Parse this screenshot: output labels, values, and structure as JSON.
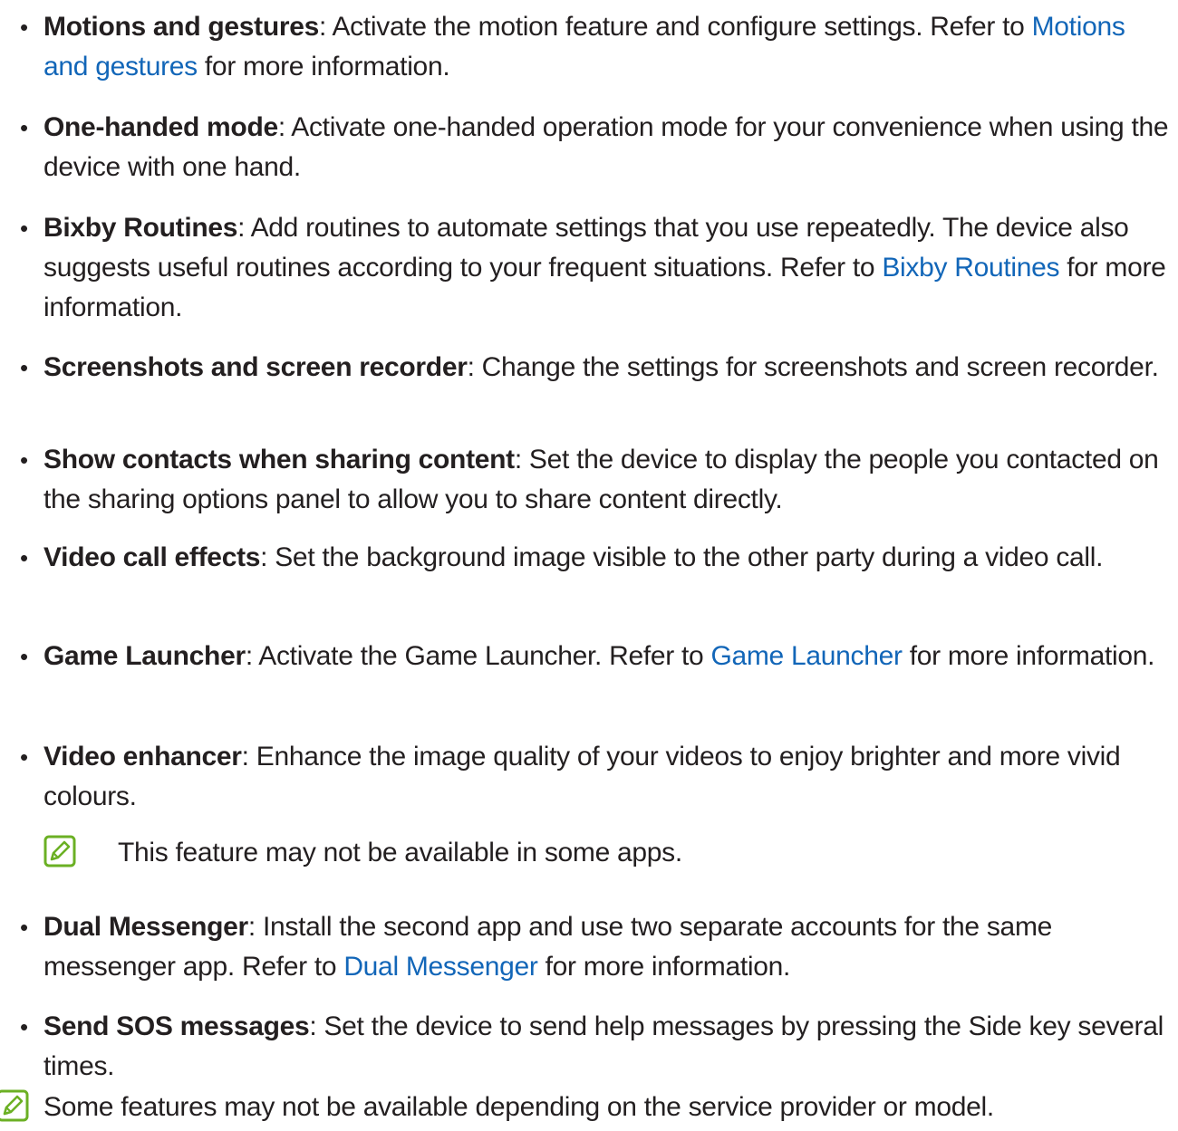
{
  "items": [
    {
      "title": "Motions and gestures",
      "parts": [
        ": Activate the motion feature and configure settings. Refer to ",
        "Motions and gestures",
        " for more information."
      ]
    },
    {
      "title": "One-handed mode",
      "parts": [
        ": Activate one-handed operation mode for your convenience when using the device with one hand."
      ]
    },
    {
      "title": "Bixby Routines",
      "parts": [
        ": Add routines to automate settings that you use repeatedly. The device also suggests useful routines according to your frequent situations. Refer to ",
        "Bixby Routines",
        " for more information."
      ]
    },
    {
      "title": "Screenshots and screen recorder",
      "parts": [
        ": Change the settings for screenshots and screen recorder."
      ]
    },
    {
      "title": "Show contacts when sharing content",
      "parts": [
        ": Set the device to display the people you contacted on the sharing options panel to allow you to share content directly."
      ]
    },
    {
      "title": "Video call effects",
      "parts": [
        ": Set the background image visible to the other party during a video call."
      ]
    },
    {
      "title": "Game Launcher",
      "parts": [
        ": Activate the Game Launcher. Refer to ",
        "Game Launcher",
        " for more information."
      ]
    },
    {
      "title": "Video enhancer",
      "parts": [
        ": Enhance the image quality of your videos to enjoy brighter and more vivid colours."
      ],
      "note": "This feature may not be available in some apps."
    },
    {
      "title": "Dual Messenger",
      "parts": [
        ": Install the second app and use two separate accounts for the same messenger app. Refer to ",
        "Dual Messenger",
        " for more information."
      ]
    },
    {
      "title": "Send SOS messages",
      "parts": [
        ": Set the device to send help messages by pressing the Side key several times."
      ]
    }
  ],
  "bullet": "•",
  "footer_note": "Some features may not be available depending on the service provider or model.",
  "colors": {
    "text": "#231f20",
    "link": "#1266b8",
    "note_icon": "#6bb024"
  },
  "icons": {
    "note": "note-pencil-icon"
  }
}
